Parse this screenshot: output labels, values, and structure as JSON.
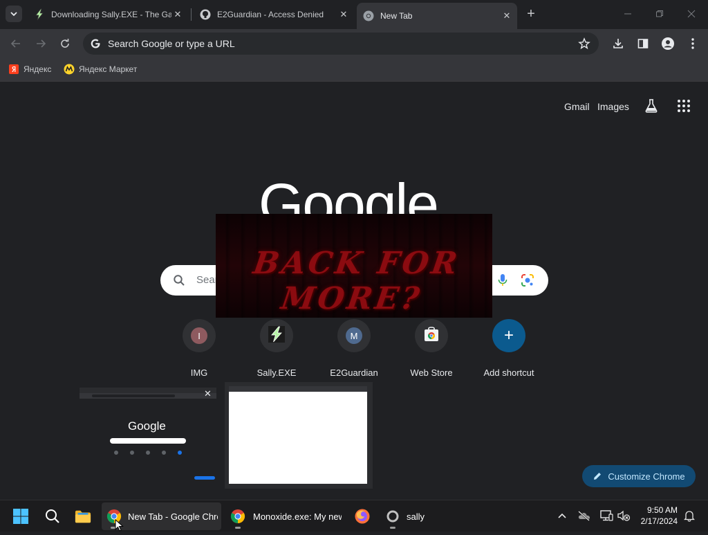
{
  "tabs": [
    {
      "title": "Downloading Sally.EXE - The Ga",
      "icon": "sally-bolt-icon"
    },
    {
      "title": "E2Guardian - Access Denied",
      "icon": "github-icon"
    },
    {
      "title": "New Tab",
      "icon": "chrome-icon",
      "active": true
    }
  ],
  "omnibox": {
    "placeholder": "Search Google or type a URL"
  },
  "bookmarks": [
    {
      "label": "Яндекс",
      "icon": "yandex-icon"
    },
    {
      "label": "Яндекс Маркет",
      "icon": "yandex-market-icon"
    }
  ],
  "ntp": {
    "links": [
      "Gmail",
      "Images"
    ],
    "logo_text": "Google",
    "search_placeholder": "Sear",
    "shortcuts": [
      {
        "label": "IMG",
        "letter": "I",
        "color": "#8e5a5f"
      },
      {
        "label": "Sally.EXE",
        "letter": "",
        "color": ""
      },
      {
        "label": "E2Guardian",
        "letter": "M",
        "color": "#4f6a8f"
      },
      {
        "label": "Web Store",
        "letter": "",
        "color": ""
      },
      {
        "label": "Add shortcut",
        "letter": "+",
        "color": "#0b5a8e"
      }
    ],
    "customize_label": "Customize Chrome"
  },
  "overlay": {
    "message": "BACK FOR MORE?"
  },
  "thumbnail": {
    "logo_text": "Google",
    "close_glyph": "✕"
  },
  "taskbar": {
    "apps": [
      {
        "label": "New Tab - Google Chrome",
        "icon": "chrome-icon"
      },
      {
        "label": "Monoxide.exe: My new",
        "icon": "chrome-icon"
      },
      {
        "label": "",
        "icon": "firefox-icon"
      },
      {
        "label": "sally",
        "icon": "sally-ring-icon"
      }
    ],
    "time": "9:50 AM",
    "date": "2/17/2024"
  }
}
